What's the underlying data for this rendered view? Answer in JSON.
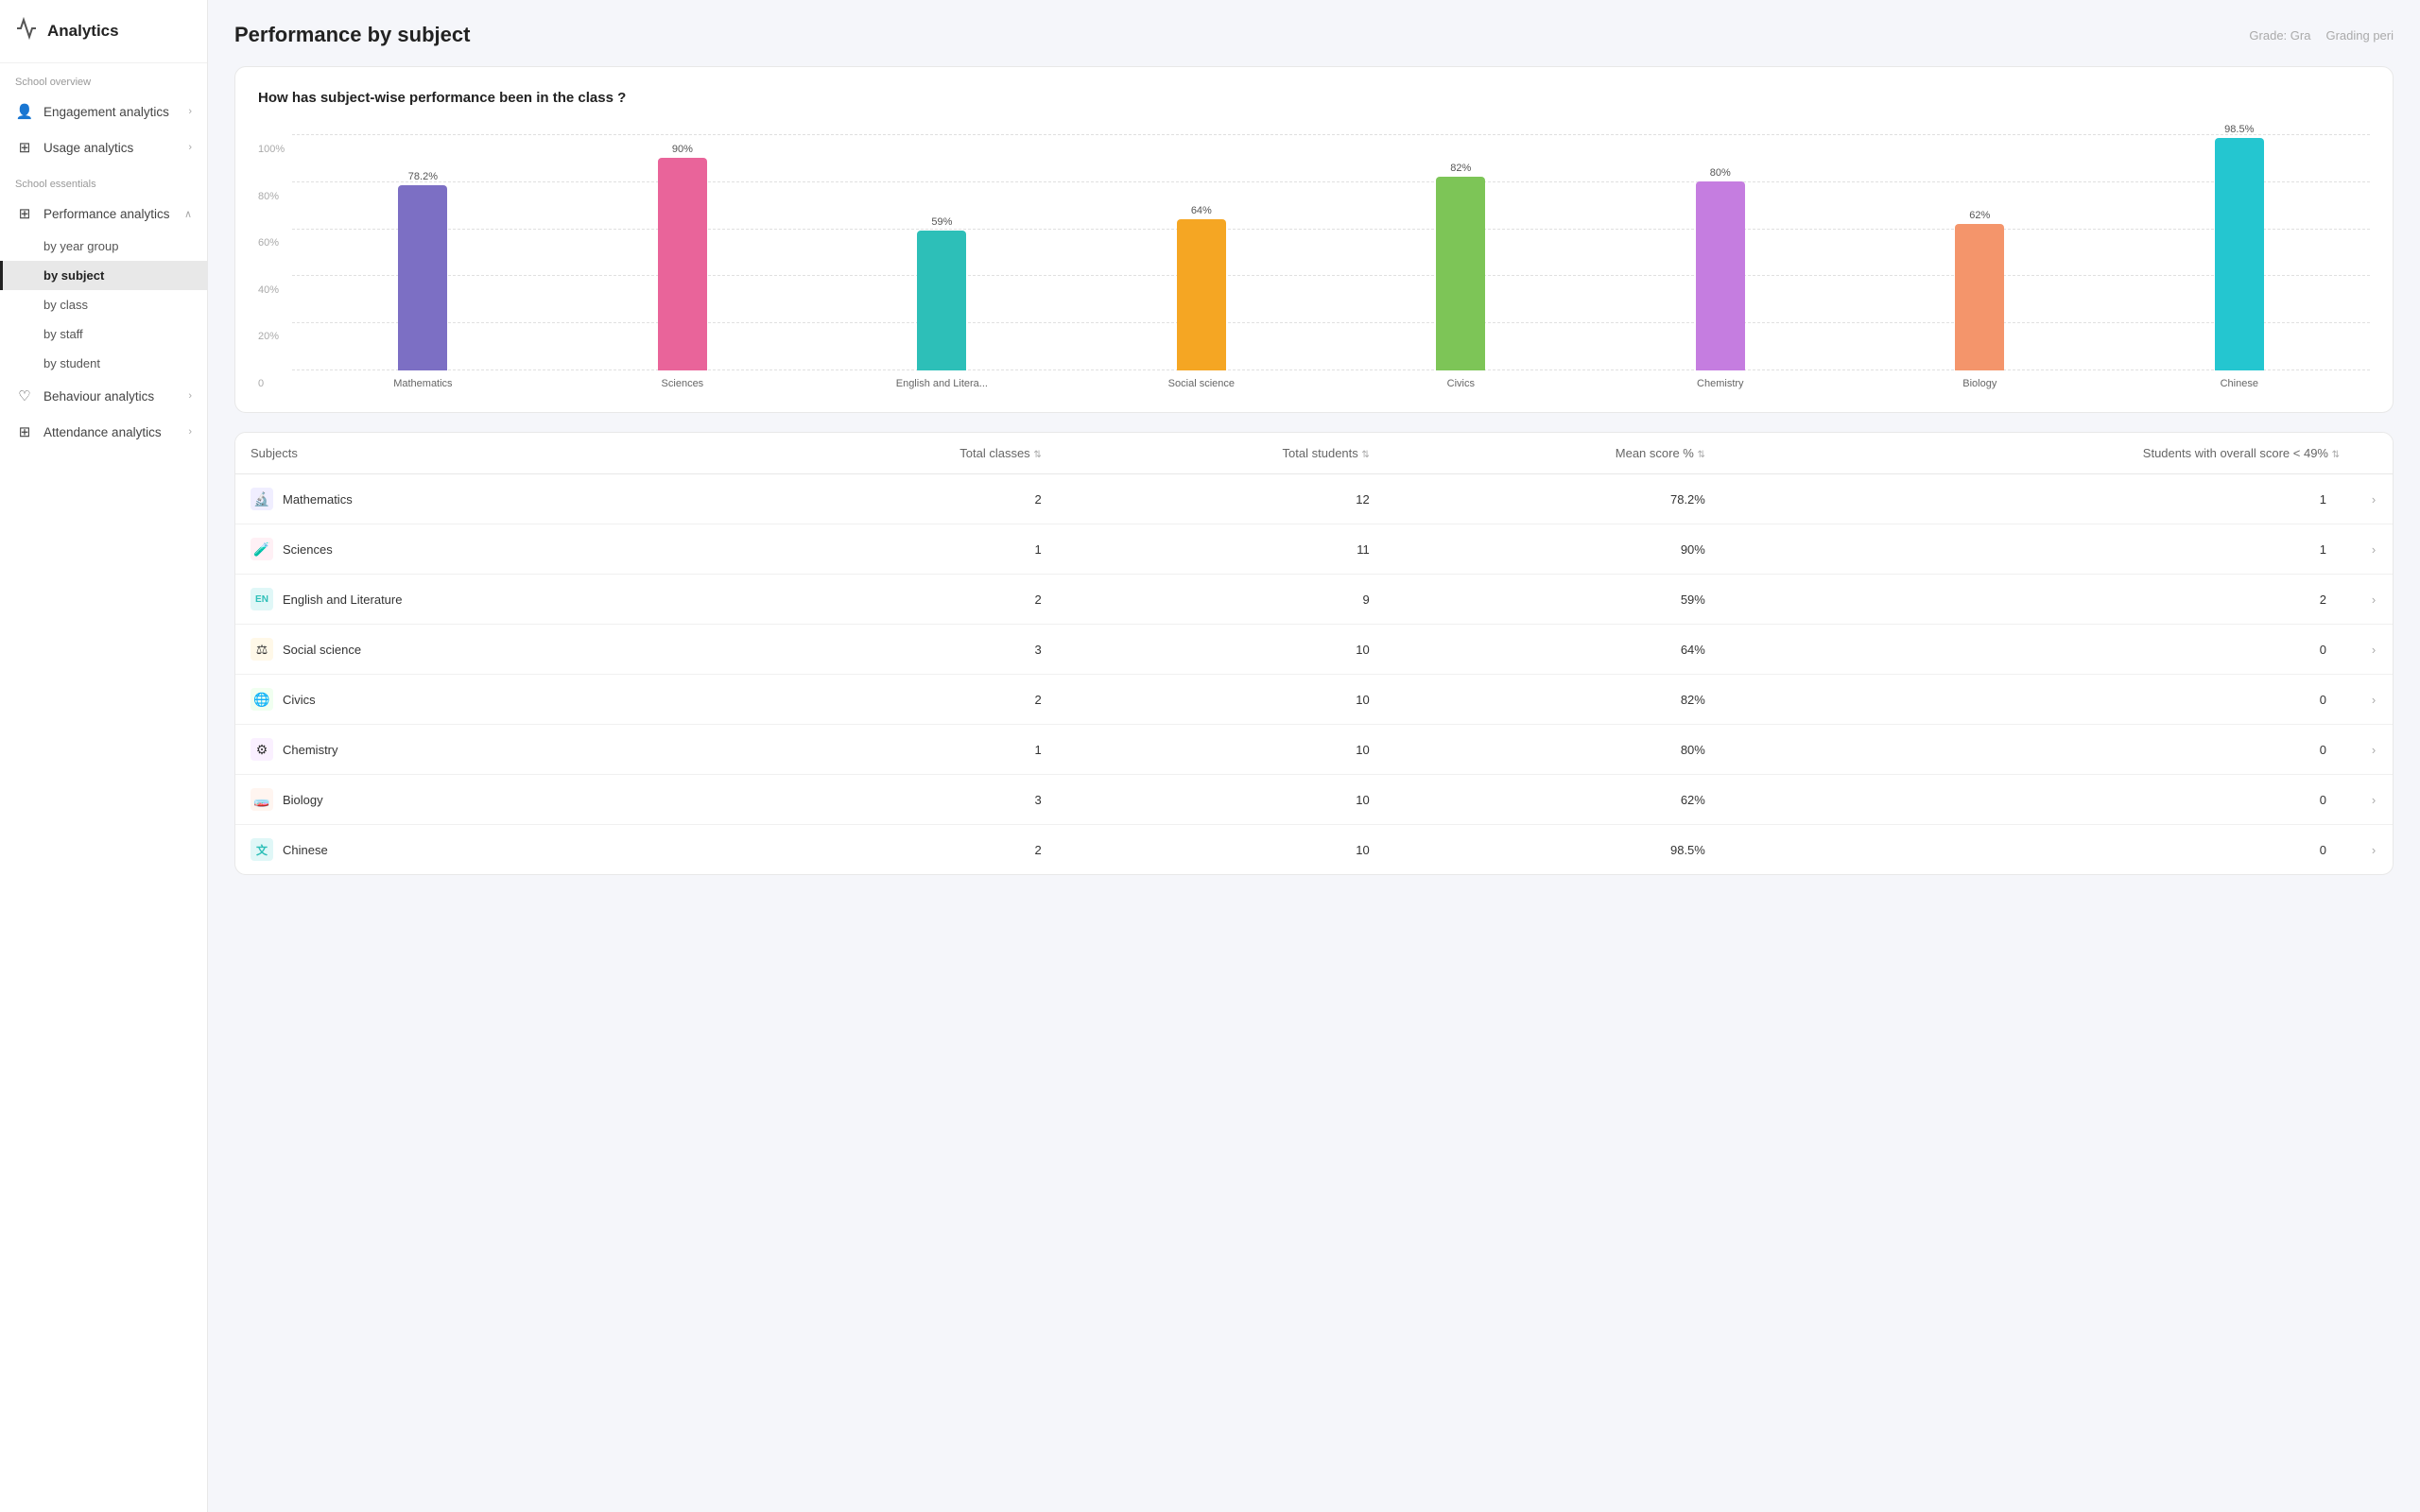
{
  "sidebar": {
    "logo_text": "Analytics",
    "logo_icon": "📊",
    "sections": [
      {
        "label": "School overview",
        "items": [
          {
            "id": "engagement",
            "label": "Engagement analytics",
            "icon": "👤",
            "has_arrow": true,
            "expanded": false
          },
          {
            "id": "usage",
            "label": "Usage analytics",
            "icon": "⊞",
            "has_arrow": true,
            "expanded": false
          }
        ]
      },
      {
        "label": "School essentials",
        "items": [
          {
            "id": "performance",
            "label": "Performance analytics",
            "icon": "⊞",
            "has_arrow": true,
            "expanded": true,
            "sub_items": [
              {
                "id": "by-year-group",
                "label": "by year group",
                "active": false
              },
              {
                "id": "by-subject",
                "label": "by subject",
                "active": true
              },
              {
                "id": "by-class",
                "label": "by class",
                "active": false
              },
              {
                "id": "by-staff",
                "label": "by staff",
                "active": false
              },
              {
                "id": "by-student",
                "label": "by student",
                "active": false
              }
            ]
          },
          {
            "id": "behaviour",
            "label": "Behaviour analytics",
            "icon": "♡",
            "has_arrow": true,
            "expanded": false
          },
          {
            "id": "attendance",
            "label": "Attendance analytics",
            "icon": "⊞",
            "has_arrow": true,
            "expanded": false
          }
        ]
      }
    ]
  },
  "page": {
    "title": "Performance by subject",
    "filters": [
      "Grade: Gra",
      "Grading peri"
    ]
  },
  "chart": {
    "title": "How has subject-wise performance been in the class ?",
    "y_labels": [
      "100%",
      "80%",
      "60%",
      "40%",
      "20%",
      "0"
    ],
    "bars": [
      {
        "label": "Mathematics",
        "value": 78.2,
        "display": "78.2%",
        "color": "#7c6fc4"
      },
      {
        "label": "Sciences",
        "value": 90,
        "display": "90%",
        "color": "#e9649a"
      },
      {
        "label": "English and Litera...",
        "value": 59,
        "display": "59%",
        "color": "#2dbfb8"
      },
      {
        "label": "Social science",
        "value": 64,
        "display": "64%",
        "color": "#f5a623"
      },
      {
        "label": "Civics",
        "value": 82,
        "display": "82%",
        "color": "#7dc557"
      },
      {
        "label": "Chemistry",
        "value": 80,
        "display": "80%",
        "color": "#c57de0"
      },
      {
        "label": "Biology",
        "value": 62,
        "display": "62%",
        "color": "#f4956b"
      },
      {
        "label": "Chinese",
        "value": 98.5,
        "display": "98.5%",
        "color": "#24c6d0"
      }
    ]
  },
  "table": {
    "columns": [
      "Subjects",
      "Total classes",
      "Total students",
      "Mean score %",
      "Students with overall score < 49%"
    ],
    "rows": [
      {
        "subject": "Mathematics",
        "icon": "🔬",
        "icon_bg": "#f0eeff",
        "total_classes": 2,
        "total_students": 12,
        "mean_score": "78.2%",
        "low_score": 1
      },
      {
        "subject": "Sciences",
        "icon": "🧪",
        "icon_bg": "#fff0f5",
        "total_classes": 1,
        "total_students": 11,
        "mean_score": "90%",
        "low_score": 1
      },
      {
        "subject": "English and Literature",
        "icon": "EN",
        "icon_bg": "#e0f7f7",
        "total_classes": 2,
        "total_students": 9,
        "mean_score": "59%",
        "low_score": 2
      },
      {
        "subject": "Social science",
        "icon": "⚖",
        "icon_bg": "#fff8e8",
        "total_classes": 3,
        "total_students": 10,
        "mean_score": "64%",
        "low_score": 0
      },
      {
        "subject": "Civics",
        "icon": "🌐",
        "icon_bg": "#f0fff0",
        "total_classes": 2,
        "total_students": 10,
        "mean_score": "82%",
        "low_score": 0
      },
      {
        "subject": "Chemistry",
        "icon": "⚙",
        "icon_bg": "#faf0ff",
        "total_classes": 1,
        "total_students": 10,
        "mean_score": "80%",
        "low_score": 0
      },
      {
        "subject": "Biology",
        "icon": "🧫",
        "icon_bg": "#fff5f0",
        "total_classes": 3,
        "total_students": 10,
        "mean_score": "62%",
        "low_score": 0
      },
      {
        "subject": "Chinese",
        "icon": "文",
        "icon_bg": "#e0f7f7",
        "total_classes": 2,
        "total_students": 10,
        "mean_score": "98.5%",
        "low_score": 0
      }
    ]
  }
}
